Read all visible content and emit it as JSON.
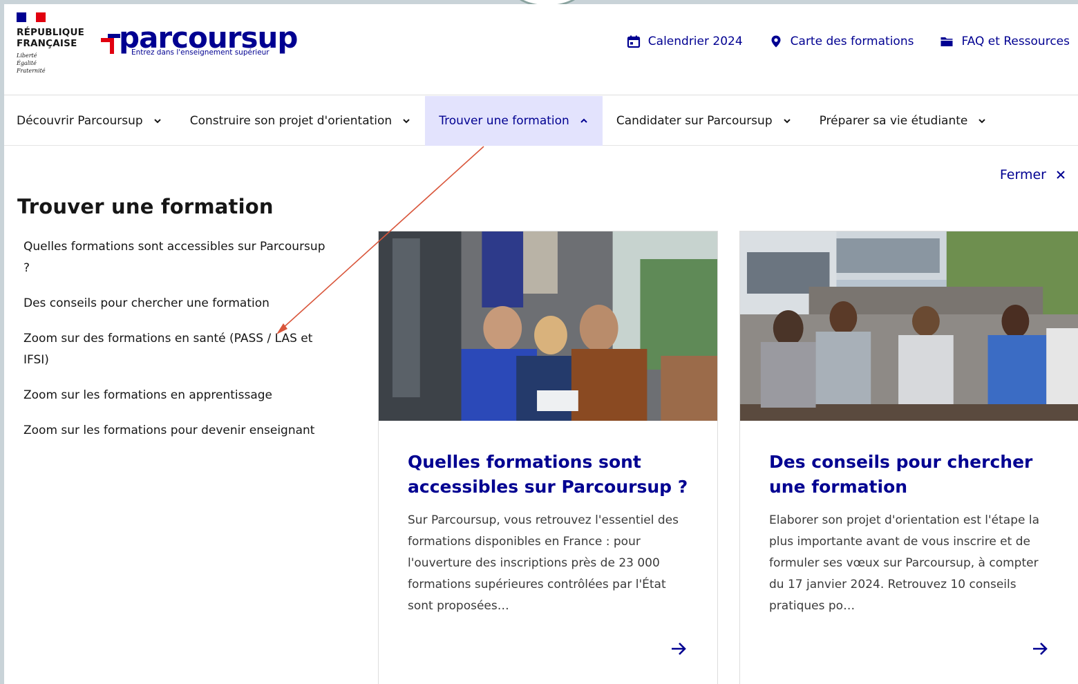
{
  "header": {
    "republique": "RÉPUBLIQUE\nFRANÇAISE",
    "devise": "Liberté\nÉgalité\nFraternité",
    "logo_word": "parcoursup",
    "logo_tagline": "Entrez dans l'enseignement supérieur",
    "links": [
      {
        "label": "Calendrier 2024",
        "icon": "calendar-icon"
      },
      {
        "label": "Carte des formations",
        "icon": "map-pin-icon"
      },
      {
        "label": "FAQ et Ressources",
        "icon": "folder-icon"
      }
    ]
  },
  "nav": {
    "items": [
      {
        "label": "Découvrir Parcoursup"
      },
      {
        "label": "Construire son projet d'orientation"
      },
      {
        "label": "Trouver une formation",
        "active": true
      },
      {
        "label": "Candidater sur Parcoursup"
      },
      {
        "label": "Préparer sa vie étudiante"
      }
    ]
  },
  "menu": {
    "close_label": "Fermer",
    "title": "Trouver une formation",
    "links": [
      "Quelles formations sont accessibles sur Parcoursup ?",
      "Des conseils pour chercher une formation",
      "Zoom sur des formations en santé (PASS / LAS et IFSI)",
      "Zoom sur les formations en apprentissage",
      "Zoom sur les formations pour devenir enseignant"
    ]
  },
  "cards": [
    {
      "title": "Quelles formations sont accessibles sur Parcoursup ?",
      "desc": "Sur Parcoursup, vous retrouvez l'essentiel des formations disponibles en France : pour l'ouverture des inscriptions près de 23 000 formations supérieures contrôlées par l'État sont proposées…"
    },
    {
      "title": "Des conseils pour chercher une formation",
      "desc": "Elaborer son projet d'orientation est l'étape la plus importante avant de vous inscrire et de formuler ses vœux sur Parcoursup, à compter du 17 janvier 2024. Retrouvez 10 conseils pratiques po…"
    }
  ],
  "colors": {
    "brand_blue": "#000091",
    "active_bg": "#e3e3fd",
    "flag_red": "#e1000f",
    "annotation": "#d9563b"
  }
}
